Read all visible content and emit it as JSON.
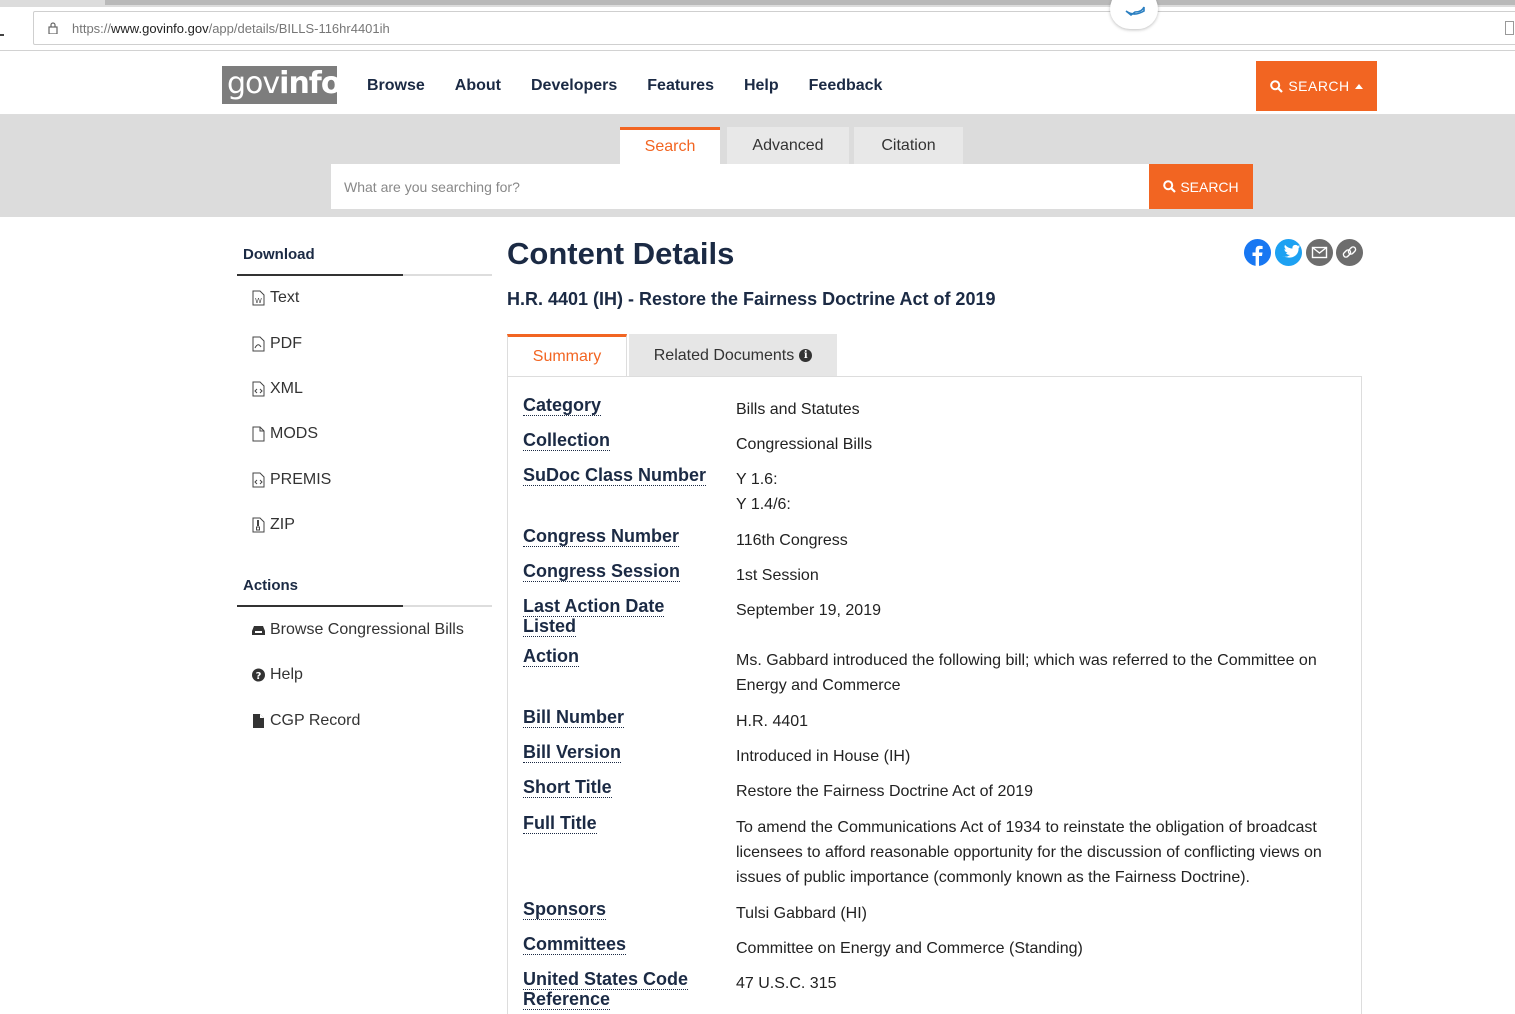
{
  "browser": {
    "url_prefix": "https://",
    "url_host": "www.govinfo.gov",
    "url_path": "/app/details/BILLS-116hr4401ih"
  },
  "header": {
    "logo_gov": "gov",
    "logo_info": "info",
    "nav": [
      "Browse",
      "About",
      "Developers",
      "Features",
      "Help",
      "Feedback"
    ],
    "search_button": "SEARCH"
  },
  "search": {
    "tabs": [
      "Search",
      "Advanced",
      "Citation"
    ],
    "active_tab": "Search",
    "placeholder": "What are you searching for?",
    "button": "SEARCH"
  },
  "sidebar": {
    "download_heading": "Download",
    "download_items": [
      "Text",
      "PDF",
      "XML",
      "MODS",
      "PREMIS",
      "ZIP"
    ],
    "actions_heading": "Actions",
    "action_items": [
      "Browse Congressional Bills",
      "Help",
      "CGP Record"
    ]
  },
  "main": {
    "title": "Content Details",
    "subtitle": "H.R. 4401 (IH) - Restore the Fairness Doctrine Act of 2019",
    "tabs": [
      "Summary",
      "Related Documents"
    ],
    "share_icons": [
      "facebook-icon",
      "twitter-icon",
      "email-icon",
      "link-icon"
    ],
    "details": [
      {
        "label": "Category",
        "value": "Bills and Statutes"
      },
      {
        "label": "Collection",
        "value": "Congressional Bills"
      },
      {
        "label": "SuDoc Class Number",
        "value": "Y 1.6:",
        "value2": "Y 1.4/6:"
      },
      {
        "label": "Congress Number",
        "value": "116th Congress"
      },
      {
        "label": "Congress Session",
        "value": "1st Session"
      },
      {
        "label": "Last Action Date Listed",
        "value": "September 19, 2019"
      },
      {
        "label": "Action",
        "value": "Ms. Gabbard introduced the following bill; which was referred to the Committee on Energy and Commerce"
      },
      {
        "label": "Bill Number",
        "value": "H.R. 4401"
      },
      {
        "label": "Bill Version",
        "value": "Introduced in House (IH)"
      },
      {
        "label": "Short Title",
        "value": "Restore the Fairness Doctrine Act of 2019"
      },
      {
        "label": "Full Title",
        "value": "To amend the Communications Act of 1934 to reinstate the obligation of broadcast licensees to afford reasonable opportunity for the discussion of conflicting views on issues of public importance (commonly known as the Fairness Doctrine)."
      },
      {
        "label": "Sponsors",
        "value": "Tulsi Gabbard (HI)"
      },
      {
        "label": "Committees",
        "value": "Committee on Energy and Commerce (Standing)"
      },
      {
        "label": "United States Code Reference",
        "value": "47 U.S.C. 315"
      }
    ]
  },
  "colors": {
    "accent": "#f26522",
    "navy": "#1b2a44",
    "band": "#dcdcdc"
  }
}
